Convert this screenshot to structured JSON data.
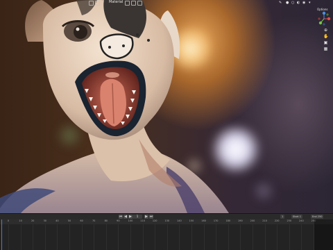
{
  "viewport": {
    "header": {
      "shading_label": "Material",
      "options_label": "Options"
    },
    "gizmo": {
      "axes": [
        "X",
        "Y",
        "Z"
      ],
      "colors": {
        "x": "#e34a4a",
        "y": "#74c442",
        "z": "#4a8fe3"
      }
    },
    "nav_icons": [
      "zoom-icon",
      "pan-hand-icon",
      "camera-icon",
      "grid-icon"
    ]
  },
  "timeline": {
    "current_frame": "1",
    "start_label": "Start",
    "start_value": "1",
    "end_label": "End",
    "end_value": "250",
    "ruler_ticks": [
      "0",
      "10",
      "20",
      "30",
      "40",
      "50",
      "60",
      "70",
      "80",
      "90",
      "100",
      "110",
      "120",
      "130",
      "140",
      "150",
      "160",
      "170",
      "180",
      "190",
      "200",
      "210",
      "220",
      "230",
      "240",
      "250"
    ]
  },
  "colors": {
    "timeline_bg": "#232323",
    "header_bg": "#2a2a2a",
    "playhead": "#4d7fc4"
  }
}
